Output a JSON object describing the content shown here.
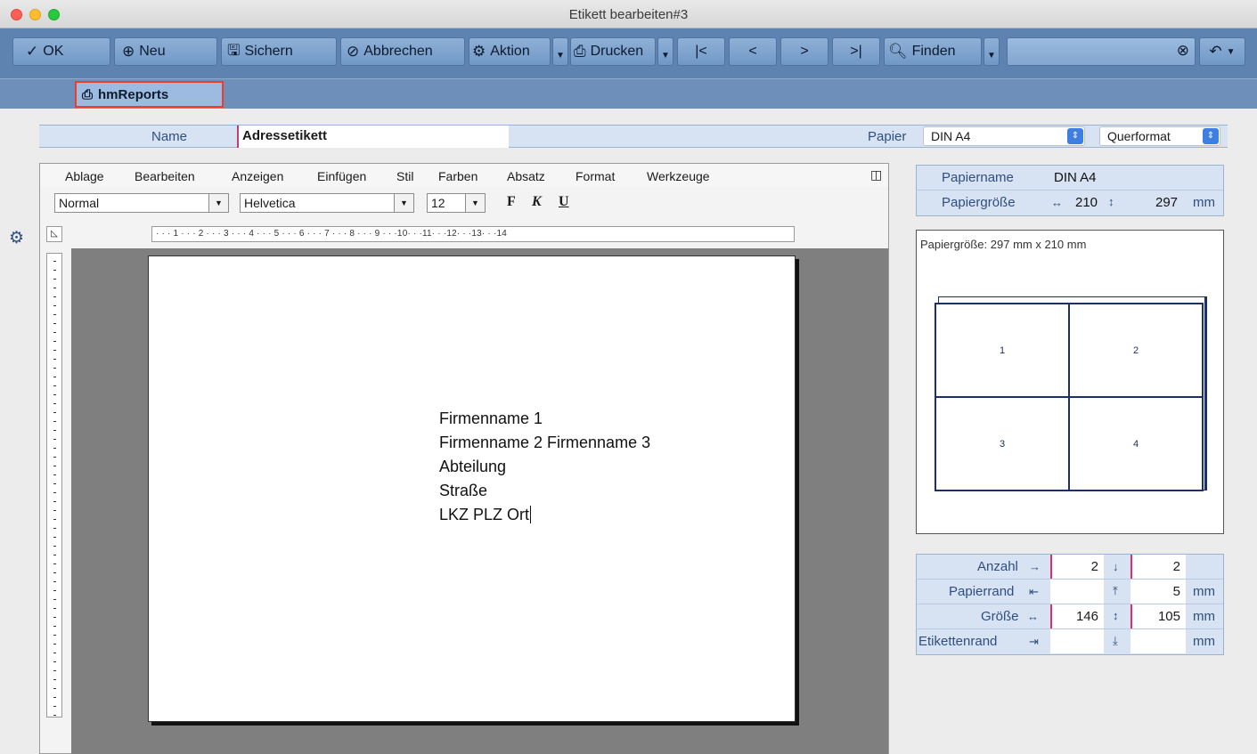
{
  "window": {
    "title": "Etikett bearbeiten#3"
  },
  "toolbar": {
    "ok": "OK",
    "new": "Neu",
    "save": "Sichern",
    "cancel": "Abbrechen",
    "action": "Aktion",
    "print": "Drucken",
    "first": "|<",
    "prev": "<",
    "next": ">",
    "last": ">|",
    "find": "Finden",
    "search_value": ""
  },
  "tabs": {
    "hmreports": "hmReports"
  },
  "form": {
    "name_label": "Name",
    "name_value": "Adressetikett",
    "paper_label": "Papier",
    "paper_value": "DIN A4",
    "orientation_value": "Querformat"
  },
  "editor": {
    "menu": [
      "Ablage",
      "Bearbeiten",
      "Anzeigen",
      "Einfügen",
      "Stil",
      "Farben",
      "Absatz",
      "Format",
      "Werkzeuge"
    ],
    "style_value": "Normal",
    "font_value": "Helvetica",
    "size_value": "12",
    "bold": "F",
    "italic": "K",
    "underline": "U",
    "ruler_text": "· · · 1 · · · 2 · · · 3 · · · 4 · · · 5 · · · 6 · · · 7 · · · 8 · · · 9 · · ·10· · ·11· · ·12· · ·13· · ·14",
    "address_lines": [
      "Firmenname 1",
      "Firmenname 2 Firmenname 3",
      "Abteilung",
      "Straße",
      "LKZ PLZ Ort"
    ]
  },
  "paper_info": {
    "name_label": "Papiername",
    "name_value": "DIN A4",
    "size_label": "Papiergröße",
    "width": "210",
    "height": "297",
    "unit": "mm"
  },
  "preview": {
    "caption": "Papiergröße: 297 mm  x 210 mm",
    "cells": [
      "1",
      "2",
      "3",
      "4"
    ]
  },
  "label_settings": {
    "count_label": "Anzahl",
    "count_x": "2",
    "count_y": "2",
    "margin_label": "Papierrand",
    "margin_x": "",
    "margin_y": "5",
    "margin_unit": "mm",
    "size_label": "Größe",
    "size_w": "146",
    "size_h": "105",
    "size_unit": "mm",
    "label_margin_label": "Etikettenrand",
    "label_margin_x": "",
    "label_margin_y": "",
    "label_margin_unit": "mm"
  },
  "colors": {
    "toolbar": "#5e83b0",
    "tab_highlight": "#e8402a",
    "label_text": "#2f4e80"
  }
}
